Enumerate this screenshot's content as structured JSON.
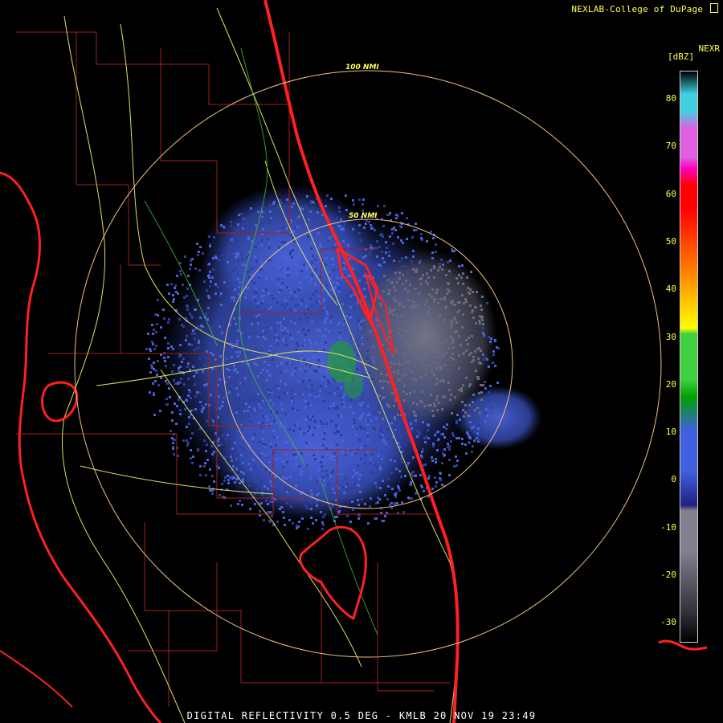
{
  "credit": "NEXLAB-College of DuPage",
  "product": "NEXR",
  "units": "[dBZ]",
  "caption": "DIGITAL REFLECTIVITY 0.5 DEG - KMLB 20 NOV 19 23:49",
  "range_rings": [
    {
      "label": "100 NMI"
    },
    {
      "label": "50 NMI"
    }
  ],
  "colorbar": {
    "ticks": [
      "80",
      "70",
      "60",
      "50",
      "40",
      "30",
      "20",
      "10",
      "0",
      "-10",
      "-20",
      "-30"
    ],
    "colors": {
      "light_blue": "#40d0e0",
      "pink": "#e060e0",
      "magenta": "#ff00c0",
      "red": "#ff0000",
      "orange": "#ff7f00",
      "yellow": "#ffff00",
      "green_light": "#40d040",
      "green_dark": "#00a000",
      "blue": "#4060e0",
      "navy": "#202080",
      "gray_light": "#808090",
      "gray_dark": "#303038"
    }
  },
  "colors": {
    "coastline": "#ff2020",
    "county_lines": "#b02020",
    "roads": "#e0e060",
    "rivers": "#40c040",
    "ring": "#f0c080",
    "echo_blue": "#4a63d8",
    "echo_gray": "#6a6a78",
    "echo_green": "#20a030"
  },
  "radar_site": "KMLB"
}
